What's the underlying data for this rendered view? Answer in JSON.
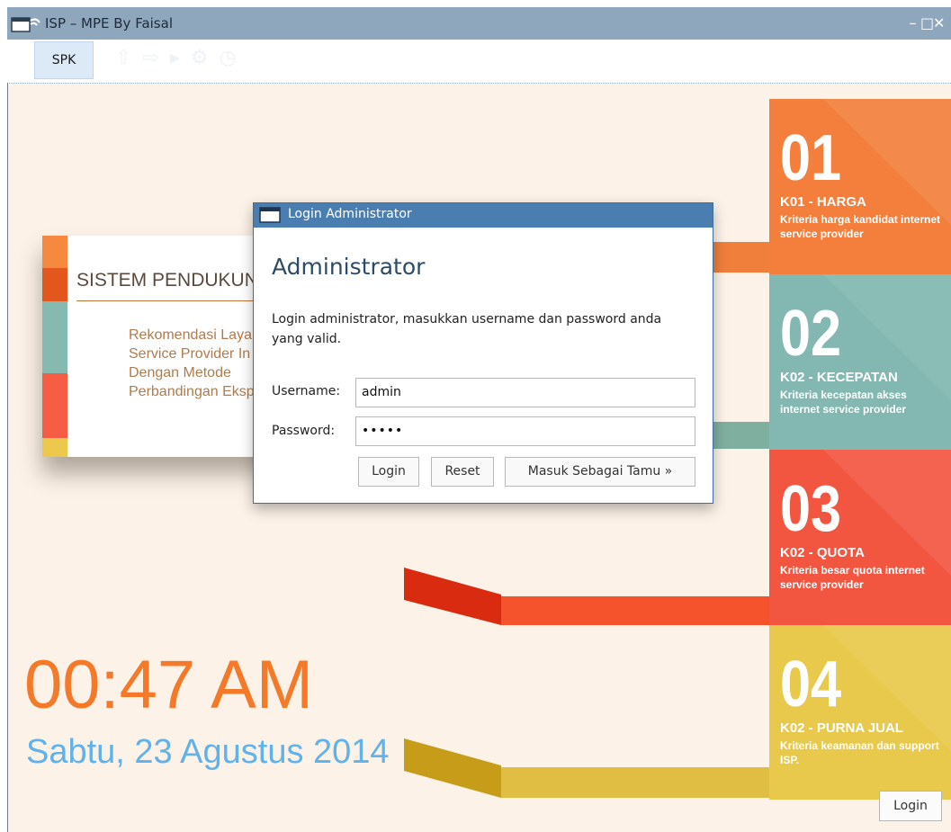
{
  "window": {
    "title": "ISP – MPE By Faisal",
    "controls": [
      "–",
      "□",
      "✕"
    ]
  },
  "toolbar": {
    "tab_label": "SPK"
  },
  "card": {
    "heading": "SISTEM PENDUKUNG",
    "lines": [
      "Rekomendasi Laya",
      "Service Provider In",
      "Dengan Metode",
      "Perbandingan Eksp"
    ],
    "stripe_colors": [
      "#f5893f",
      "#e2571e",
      "#86b9b0",
      "#f55d45",
      "#ecc94c"
    ]
  },
  "tiles": [
    {
      "num": "01",
      "code": "K01 - HARGA",
      "sub": "Kriteria harga kandidat internet service provider",
      "color": "#f47f3d"
    },
    {
      "num": "02",
      "code": "K02 - KECEPATAN",
      "sub": "Kriteria kecepatan akses internet service provider",
      "color": "#82b8b1"
    },
    {
      "num": "03",
      "code": "K02 - QUOTA",
      "sub": "Kriteria besar quota internet service provider",
      "color": "#f35640"
    },
    {
      "num": "04",
      "code": "K02 - PURNA JUAL",
      "sub": "Kriteria keamanan dan support ISP.",
      "color": "#e9c94b"
    }
  ],
  "clock": {
    "time": "00:47 AM",
    "date": "Sabtu, 23 Agustus 2014"
  },
  "login_button": "Login",
  "dialog": {
    "title": "Login Administrator",
    "heading": "Administrator",
    "message": "Login administrator, masukkan username dan password anda yang valid.",
    "username_label": "Username:",
    "username_value": "admin",
    "password_label": "Password:",
    "password_value": "•••••",
    "login_label": "Login",
    "reset_label": "Reset",
    "guest_label": "Masuk Sebagai Tamu »"
  }
}
